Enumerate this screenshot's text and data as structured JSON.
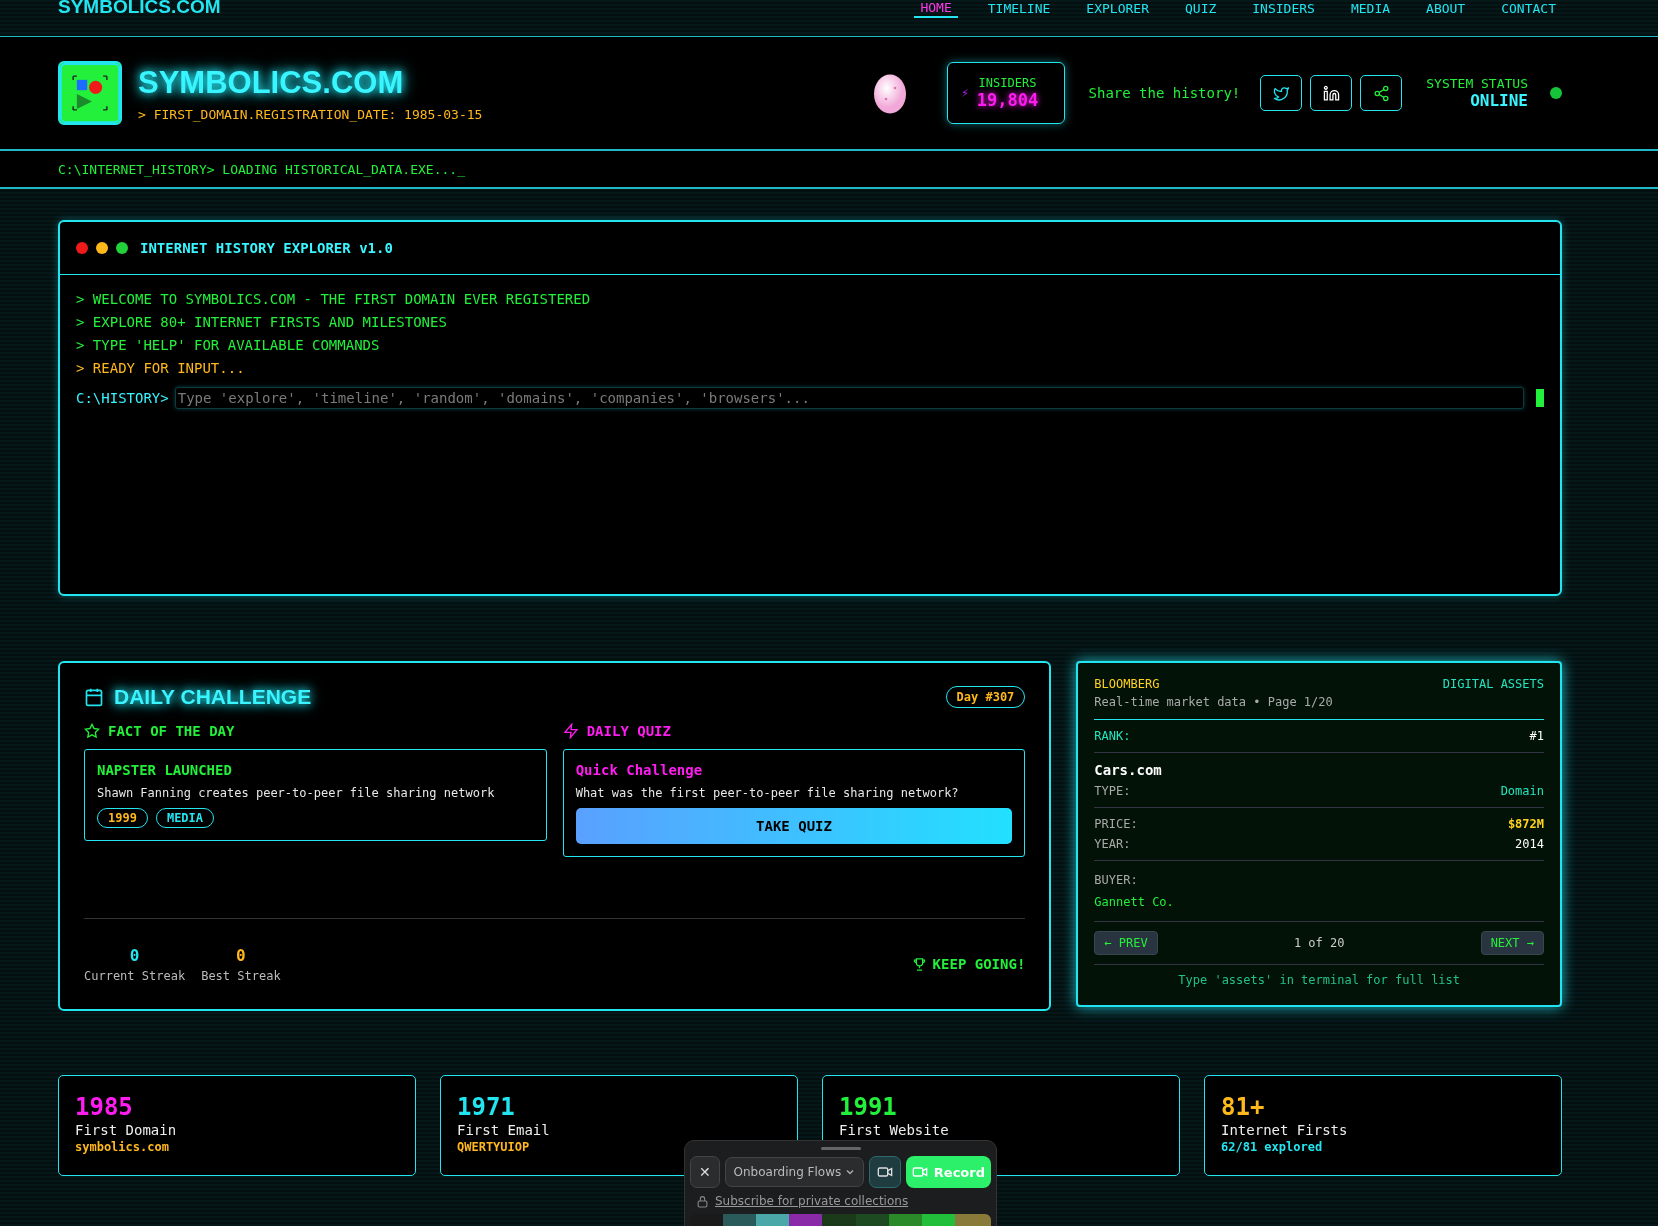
{
  "nav": {
    "brand": "SYMBOLICS.COM",
    "items": [
      {
        "label": "HOME",
        "selected": true
      },
      {
        "label": "TIMELINE",
        "selected": false
      },
      {
        "label": "EXPLORER",
        "selected": false
      },
      {
        "label": "QUIZ",
        "selected": false
      },
      {
        "label": "INSIDERS",
        "selected": false
      },
      {
        "label": "MEDIA",
        "selected": false
      },
      {
        "label": "ABOUT",
        "selected": false
      },
      {
        "label": "CONTACT",
        "selected": false
      }
    ]
  },
  "header": {
    "title": "SYMBOLICS.COM",
    "subtitle": "> FIRST_DOMAIN.REGISTRATION_DATE: 1985-03-15",
    "insiders": {
      "label": "INSIDERS",
      "icon": "⚡",
      "count": "19,804"
    },
    "share_label": "Share the history!",
    "status": {
      "label": "SYSTEM STATUS",
      "value": "ONLINE"
    }
  },
  "loading_line": "C:\\INTERNET_HISTORY> LOADING HISTORICAL_DATA.EXE..._",
  "terminal": {
    "title": "INTERNET HISTORY EXPLORER v1.0",
    "lines": [
      {
        "text": "> WELCOME TO SYMBOLICS.COM - THE FIRST DOMAIN EVER REGISTERED",
        "kind": "info"
      },
      {
        "text": "> EXPLORE 80+ INTERNET FIRSTS AND MILESTONES",
        "kind": "info"
      },
      {
        "text": "> TYPE 'HELP' FOR AVAILABLE COMMANDS",
        "kind": "info"
      },
      {
        "text": "> READY FOR INPUT...",
        "kind": "prompt"
      }
    ],
    "prompt": "C:\\HISTORY>",
    "placeholder": "Type 'explore', 'timeline', 'random', 'domains', 'companies', 'browsers'..."
  },
  "daily_challenge": {
    "title": "DAILY CHALLENGE",
    "day": "Day #307",
    "fact": {
      "heading": "FACT OF THE DAY",
      "title": "NAPSTER LAUNCHED",
      "text": "Shawn Fanning creates peer-to-peer file sharing network",
      "tags": [
        {
          "label": "1999",
          "color": "#ffb81c"
        },
        {
          "label": "MEDIA",
          "color": "#22e5f0"
        }
      ]
    },
    "quiz": {
      "heading": "DAILY QUIZ",
      "title": "Quick Challenge",
      "question": "What was the first peer-to-peer file sharing network?",
      "button": "TAKE QUIZ"
    },
    "streaks": [
      {
        "value": "0",
        "label": "Current Streak",
        "color": "#22e5f0"
      },
      {
        "value": "0",
        "label": "Best Streak",
        "color": "#ffb81c"
      }
    ],
    "encouragement": "KEEP GOING!"
  },
  "assets": {
    "source": "BLOOMBERG",
    "category": "DIGITAL ASSETS",
    "subtitle": "Real-time market data • Page 1/20",
    "rank_label": "RANK:",
    "rank": "#1",
    "name": "Cars.com",
    "type_label": "TYPE:",
    "type": "Domain",
    "price_label": "PRICE:",
    "price": "$872M",
    "year_label": "YEAR:",
    "year": "2014",
    "buyer_label": "BUYER:",
    "buyer": "Gannett Co.",
    "prev": "← PREV",
    "page": "1 of 20",
    "next": "NEXT →",
    "hint": "Type 'assets' in terminal for full list"
  },
  "stats": [
    {
      "value": "1985",
      "label": "First Domain",
      "note": {
        "text": "symbolics.com",
        "color": "#ffb81c"
      },
      "color": "#ff1cf0"
    },
    {
      "value": "1971",
      "label": "First Email",
      "note": {
        "text": "QWERTYUIOP",
        "color": "#ffb81c"
      },
      "color": "#22e5f0"
    },
    {
      "value": "1991",
      "label": "First Website",
      "color": "#22f03a"
    },
    {
      "value": "81+",
      "label": "Internet Firsts",
      "note": {
        "text": "62/81 explored",
        "color": "#22e5f0"
      },
      "color": "#ffb81c"
    }
  ],
  "recorder": {
    "close": "✕",
    "dropdown": "Onboarding Flows",
    "record": "Record",
    "subscribe": "Subscribe for private collections"
  }
}
